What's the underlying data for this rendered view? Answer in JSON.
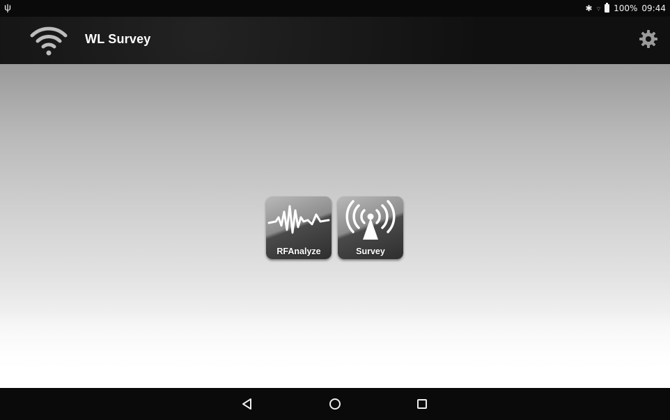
{
  "status_bar": {
    "battery_percent": "100%",
    "time": "09:44",
    "icons": [
      "usb-icon",
      "bluetooth-icon",
      "battery-icon"
    ]
  },
  "action_bar": {
    "title": "WL Survey",
    "icons": [
      "wifi-logo-icon",
      "gear-icon"
    ]
  },
  "tiles": [
    {
      "label": "RFAnalyze",
      "icon": "waveform-icon"
    },
    {
      "label": "Survey",
      "icon": "antenna-icon"
    }
  ],
  "nav_bar": {
    "icons": [
      "back-icon",
      "home-icon",
      "recents-icon"
    ]
  },
  "colors": {
    "bar_background": "#0a0a0a",
    "text_light": "#ffffff"
  }
}
